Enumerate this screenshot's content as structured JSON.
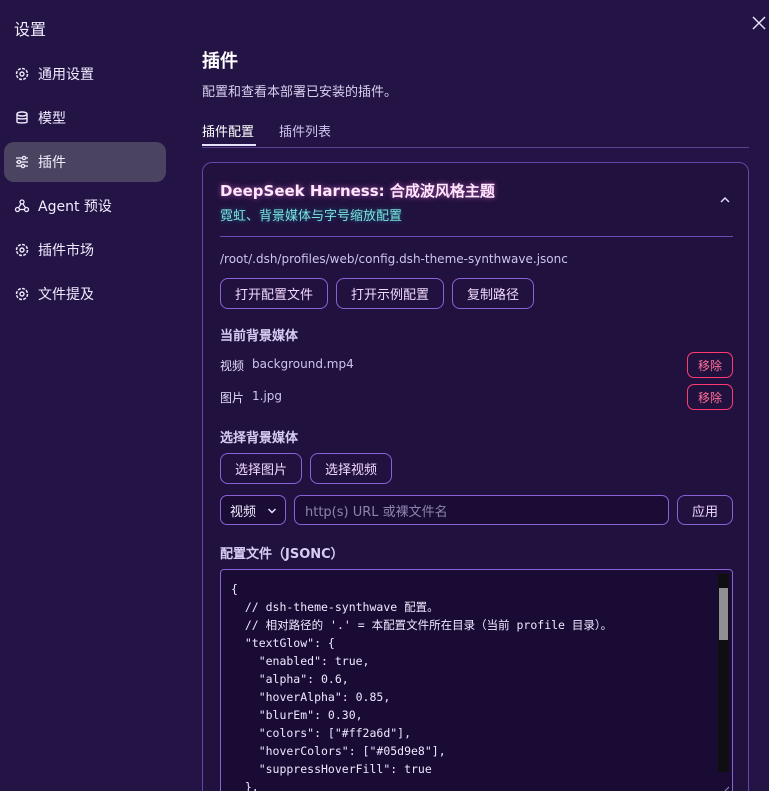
{
  "window": {
    "title": "设置"
  },
  "sidebar": {
    "items": [
      {
        "label": "通用设置",
        "icon": "gear-icon"
      },
      {
        "label": "模型",
        "icon": "database-icon"
      },
      {
        "label": "插件",
        "icon": "sliders-icon",
        "active": true
      },
      {
        "label": "Agent 预设",
        "icon": "agent-icon"
      },
      {
        "label": "插件市场",
        "icon": "gear-icon"
      },
      {
        "label": "文件提及",
        "icon": "gear-icon"
      }
    ]
  },
  "main": {
    "title": "插件",
    "description": "配置和查看本部署已安装的插件。",
    "tabs": [
      {
        "label": "插件配置",
        "active": true
      },
      {
        "label": "插件列表",
        "active": false
      }
    ]
  },
  "plugin": {
    "name": "DeepSeek Harness: 合成波风格主题",
    "subtitle": "霓虹、背景媒体与字号缩放配置",
    "config_path": "/root/.dsh/profiles/web/config.dsh-theme-synthwave.jsonc",
    "actions": {
      "open_config": "打开配置文件",
      "open_example": "打开示例配置",
      "copy_path": "复制路径"
    },
    "current_media": {
      "label": "当前背景媒体",
      "items": [
        {
          "type": "视频",
          "file": "background.mp4",
          "remove_label": "移除"
        },
        {
          "type": "图片",
          "file": "1.jpg",
          "remove_label": "移除"
        }
      ]
    },
    "select_media": {
      "label": "选择背景媒体",
      "select_image": "选择图片",
      "select_video": "选择视频",
      "media_type_value": "视频",
      "url_placeholder": "http(s) URL 或裸文件名",
      "apply_label": "应用"
    },
    "config_file": {
      "label": "配置文件（JSONC）",
      "lines": [
        "{",
        "  // dsh-theme-synthwave 配置。",
        "  // 相对路径的 '.' = 本配置文件所在目录（当前 profile 目录）。",
        "  \"textGlow\": {",
        "    \"enabled\": true,",
        "    \"alpha\": 0.6,",
        "    \"hoverAlpha\": 0.85,",
        "    \"blurEm\": 0.30,",
        "    \"colors\": [\"#ff2a6d\"],",
        "    \"hoverColors\": [\"#05d9e8\"],",
        "    \"suppressHoverFill\": true",
        "  },"
      ]
    }
  },
  "colors": {
    "background": "#241345",
    "accent_border": "#8a62d6",
    "danger": "#ff3b6e",
    "glow_pink": "#ff2a6d",
    "glow_cyan": "#05d9e8"
  }
}
